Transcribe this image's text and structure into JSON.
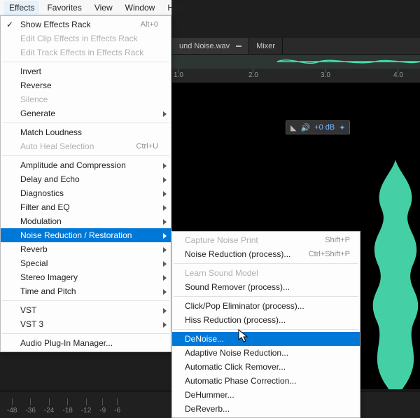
{
  "menubar": {
    "items": [
      "Effects",
      "Favorites",
      "View",
      "Window",
      "Help"
    ],
    "open_index": 0
  },
  "effects_menu": [
    {
      "label": "Show Effects Rack",
      "shortcut": "Alt+0",
      "checked": true
    },
    {
      "label": "Edit Clip Effects in Effects Rack",
      "disabled": true
    },
    {
      "label": "Edit Track Effects in Effects Rack",
      "disabled": true
    },
    {
      "sep": true
    },
    {
      "label": "Invert"
    },
    {
      "label": "Reverse"
    },
    {
      "label": "Silence",
      "disabled": true
    },
    {
      "label": "Generate",
      "submenu": true
    },
    {
      "sep": true
    },
    {
      "label": "Match Loudness"
    },
    {
      "label": "Auto Heal Selection",
      "shortcut": "Ctrl+U",
      "disabled": true
    },
    {
      "sep": true
    },
    {
      "label": "Amplitude and Compression",
      "submenu": true
    },
    {
      "label": "Delay and Echo",
      "submenu": true
    },
    {
      "label": "Diagnostics",
      "submenu": true
    },
    {
      "label": "Filter and EQ",
      "submenu": true
    },
    {
      "label": "Modulation",
      "submenu": true
    },
    {
      "label": "Noise Reduction / Restoration",
      "submenu": true,
      "highlight": true
    },
    {
      "label": "Reverb",
      "submenu": true
    },
    {
      "label": "Special",
      "submenu": true
    },
    {
      "label": "Stereo Imagery",
      "submenu": true
    },
    {
      "label": "Time and Pitch",
      "submenu": true
    },
    {
      "sep": true
    },
    {
      "label": "VST",
      "submenu": true
    },
    {
      "label": "VST 3",
      "submenu": true
    },
    {
      "sep": true
    },
    {
      "label": "Audio Plug-In Manager..."
    }
  ],
  "noise_submenu": [
    {
      "label": "Capture Noise Print",
      "shortcut": "Shift+P",
      "disabled": true
    },
    {
      "label": "Noise Reduction (process)...",
      "shortcut": "Ctrl+Shift+P"
    },
    {
      "sep": true
    },
    {
      "label": "Learn Sound Model",
      "disabled": true
    },
    {
      "label": "Sound Remover (process)..."
    },
    {
      "sep": true
    },
    {
      "label": "Click/Pop Eliminator (process)..."
    },
    {
      "label": "Hiss Reduction (process)..."
    },
    {
      "sep": true
    },
    {
      "label": "DeNoise...",
      "highlight": true
    },
    {
      "label": "Adaptive Noise Reduction..."
    },
    {
      "label": "Automatic Click Remover..."
    },
    {
      "label": "Automatic Phase Correction..."
    },
    {
      "label": "DeHummer..."
    },
    {
      "label": "DeReverb..."
    }
  ],
  "tabs": {
    "file_tab": "und Noise.wav",
    "mixer_tab": "Mixer"
  },
  "ruler_ticks": [
    "1.0",
    "2.0",
    "3.0",
    "4.0"
  ],
  "volume": {
    "db_label": "+0 dB"
  },
  "db_scale": [
    "-48",
    "-36",
    "-24",
    "-18",
    "-12",
    "-9",
    "-6"
  ],
  "colors": {
    "highlight": "#0078d7",
    "waveform": "#4be6b6"
  }
}
